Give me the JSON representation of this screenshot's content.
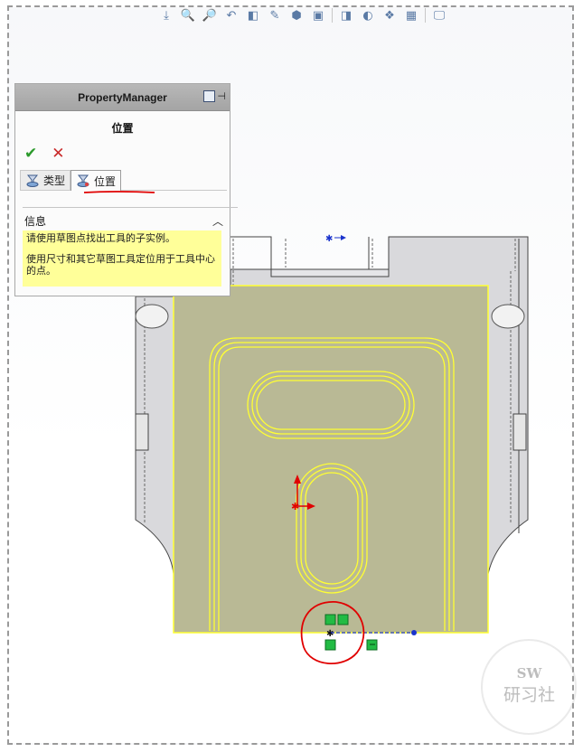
{
  "property_manager": {
    "header_title": "PropertyManager",
    "feature_title": "位置",
    "ok_symbol": "✔",
    "cancel_symbol": "✕",
    "tabs": [
      {
        "label": "类型",
        "active": false
      },
      {
        "label": "位置",
        "active": true
      }
    ],
    "info": {
      "heading": "信息",
      "collapse_glyph": "︿",
      "lines": [
        "请使用草图点找出工具的子实例。",
        "使用尺寸和其它草图工具定位用于工具中心的点。"
      ]
    }
  },
  "hud_icons": [
    "view-orient-icon",
    "zoom-fit-icon",
    "zoom-area-icon",
    "previous-view-icon",
    "section-view-icon",
    "dynamic-annotation-icon",
    "view-cube-icon",
    "display-style-icon",
    "hide-show-icon",
    "edit-appearance-icon",
    "apply-scene-icon",
    "view-settings-icon",
    "monitor-icon"
  ],
  "colors": {
    "sketch": "#ffff33",
    "face": "#b9b995",
    "accent_red": "#e00000",
    "point_blue": "#1a33cc",
    "relation_green": "#22bb44"
  },
  "watermark": {
    "line1": "SW",
    "line2": "研习社"
  }
}
